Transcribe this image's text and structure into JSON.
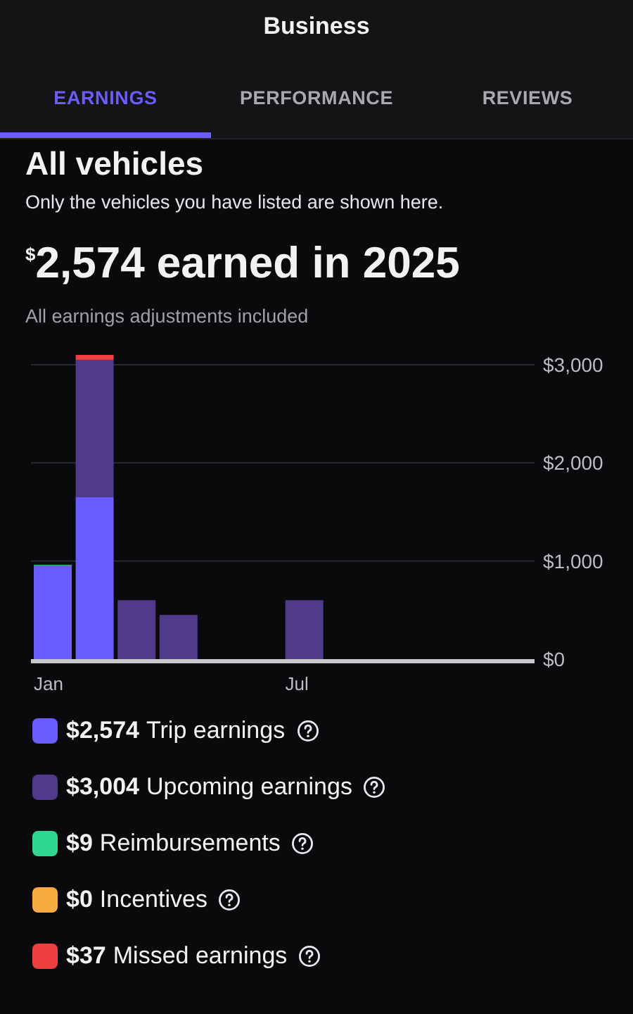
{
  "header": {
    "title": "Business"
  },
  "tabs": [
    {
      "label": "EARNINGS",
      "selected": true
    },
    {
      "label": "PERFORMANCE",
      "selected": false
    },
    {
      "label": "REVIEWS",
      "selected": false
    }
  ],
  "section": {
    "title": "All vehicles",
    "subtitle": "Only the vehicles you have listed are shown here."
  },
  "summary": {
    "currency": "$",
    "headline": "2,574 earned in 2025",
    "note": "All earnings adjustments included"
  },
  "chart_data": {
    "type": "bar",
    "stacked": true,
    "categories": [
      "Jan",
      null,
      null,
      null,
      null,
      null,
      "Jul",
      null,
      null,
      null,
      null,
      null
    ],
    "ylim": [
      0,
      3100
    ],
    "grid": true,
    "yticks": [
      {
        "value": 0,
        "label": "$0"
      },
      {
        "value": 1000,
        "label": "$1,000"
      },
      {
        "value": 2000,
        "label": "$2,000"
      },
      {
        "value": 3000,
        "label": "$3,000"
      }
    ],
    "series": [
      {
        "name": "Trip earnings",
        "color": "#6a5cff",
        "values": [
          950,
          1650,
          0,
          0,
          0,
          0,
          0,
          0,
          0,
          0,
          0,
          0
        ]
      },
      {
        "name": "Upcoming earnings",
        "color": "#4f3a8c",
        "values": [
          0,
          1400,
          600,
          450,
          0,
          0,
          600,
          0,
          0,
          0,
          0,
          0
        ]
      },
      {
        "name": "Reimbursements",
        "color": "#2ed68f",
        "values": [
          10,
          0,
          0,
          0,
          0,
          0,
          0,
          0,
          0,
          0,
          0,
          0
        ]
      },
      {
        "name": "Incentives",
        "color": "#f9ab40",
        "values": [
          0,
          0,
          0,
          0,
          0,
          0,
          0,
          0,
          0,
          0,
          0,
          0
        ]
      },
      {
        "name": "Missed earnings",
        "color": "#ef4040",
        "values": [
          0,
          50,
          0,
          0,
          0,
          0,
          0,
          0,
          0,
          0,
          0,
          0
        ]
      }
    ]
  },
  "legend": [
    {
      "amount": "$2,574"
    },
    {
      "amount": "$3,004"
    },
    {
      "amount": "$9"
    },
    {
      "amount": "$0"
    },
    {
      "amount": "$37"
    }
  ]
}
